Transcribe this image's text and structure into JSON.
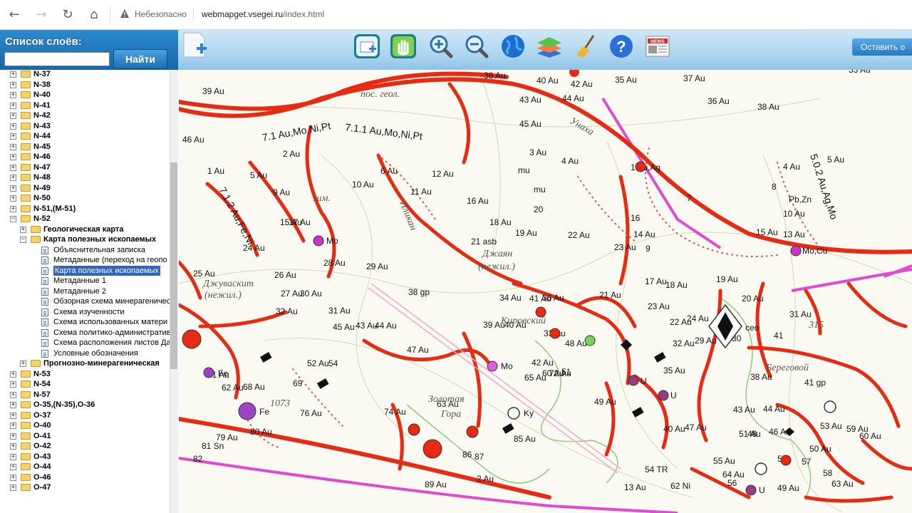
{
  "browser": {
    "insecure_label": "Небезопасно",
    "url_host": "webmapget.vsegei.ru",
    "url_path": "/index.html"
  },
  "header": {
    "layers_title": "Список слоёв:",
    "search_value": "",
    "find_label": "Найти",
    "leave_label": "Оставить о"
  },
  "tree": {
    "before": [
      "N-37",
      "N-38",
      "N-40",
      "N-41",
      "N-42",
      "N-43",
      "N-44",
      "N-45",
      "N-46",
      "N-47",
      "N-48",
      "N-49",
      "N-50",
      "N-51,(M-51)",
      "N-52"
    ],
    "n52_children": [
      "Геологическая карта",
      "Карта полезных ископаемых"
    ],
    "map_children": [
      "Объяснительная записка",
      "Метаданные (переход на геопо",
      "Карта полезных ископаемых",
      "Метаданные 1",
      "Метаданные 2",
      "Обзорная схема минерагеничес",
      "Схема изученности",
      "Схема использованных матери",
      "Схема политико-административ",
      "Схема расположения листов Да",
      "Условные обозначения"
    ],
    "forecast": "Прогнозно-минерагеническая",
    "after": [
      "N-53",
      "N-54",
      "N-57",
      "O-35,(N-35),O-36",
      "O-37",
      "O-40",
      "O-41",
      "O-42",
      "O-43",
      "O-44",
      "O-46",
      "O-47"
    ]
  },
  "map": {
    "labels": [
      "39 Au",
      "38 Au",
      "40 Au",
      "42 Au",
      "35 Au",
      "43 Au",
      "44 Au",
      "37 Au",
      "36 Au",
      "38 Au",
      "45 Au",
      "46 Au",
      "33 Au",
      "2 Au",
      "3 Au",
      "4 Au",
      "1 Au",
      "5 Au",
      "6 Au",
      "12 Au",
      "9 Au",
      "10 Au",
      "11 Au",
      "16 Au",
      "15 Au",
      "17 Au",
      "18 Au",
      "19 Au",
      "20",
      "22 Au",
      "23 Au",
      "24 Au",
      "25 Au",
      "26 Au",
      "27 Au",
      "28 Au",
      "29 Au",
      "30 Au",
      "31 Au",
      "32 Au",
      "33 Au",
      "34 Au",
      "36 Au",
      "39 Au",
      "40 Au",
      "41 Au",
      "42 Au",
      "43 Au",
      "44 Au",
      "45 Au",
      "47 Au",
      "48 Au",
      "49 Au",
      "51",
      "52 Au",
      "54",
      "60 Au",
      "61 Au",
      "62 Au",
      "63 Au",
      "65 Au",
      "68 Au",
      "69",
      "72 Au",
      "74 Au",
      "76 Au",
      "79 Au",
      "80 Au",
      "81 Sn",
      "82",
      "85 Au",
      "86",
      "87",
      "88",
      "89 Au",
      "2 Au",
      "4 Au",
      "5 Au",
      "7",
      "8",
      "10 Au",
      "13 Au",
      "14 Au",
      "15 Au",
      "17 Au",
      "18 Au",
      "19 Au",
      "20 Au",
      "21 Au",
      "22 Au",
      "23 Au",
      "24 Au",
      "27",
      "29 Au",
      "30",
      "31 Au",
      "32 Au",
      "35 Au",
      "38 Au",
      "40 Au",
      "41",
      "43 Au",
      "44 Au",
      "46 Au",
      "47 Au",
      "48",
      "49 Au",
      "50 Au",
      "51 Au",
      "52",
      "53 Au",
      "55 Au",
      "56",
      "57",
      "58",
      "59 Au",
      "60 Au",
      "62 Ni",
      "63 Au",
      "64 Au",
      "13 Au",
      "9",
      "16"
    ],
    "annotations": {
      "trend_1": "7.1 Au,Mo,Ni,Pt",
      "trend_2": "7.1.1 Au,Mo,Ni,Pt",
      "trend_3": "7.1.2 Au,Fe,Ni",
      "trend_4": "5.0.2 Au,Ag,Mo",
      "pos_geol": "пос. геол.",
      "zim": "зим.",
      "dzhayan": "Джаян",
      "nezhil": "(нежил.)",
      "dzhuvaskit": "Джуваскит",
      "nezhil2": "(нежил.)",
      "kirovskiy": "Кировский",
      "zolotaya": "Золотая",
      "gora": "Гора",
      "beregovoy": "Береговой",
      "unakha": "Унаха",
      "elev_1073": "1073",
      "elev_315": "315",
      "ilikan": "Иликан",
      "mo20": "Mo",
      "mo16": "Mo,Cu",
      "mo64": "Mo",
      "fe73": "Fe",
      "fe71": "Fe",
      "ag1": "1 Au,Ag",
      "pbzn": "Pb,Zn",
      "mu7": "mu",
      "mu13": "mu",
      "asb21": "21 asb",
      "gp38": "38 gp",
      "gp41": "41 gp",
      "ce": "ceo",
      "ky": "Ky",
      "u36": "U",
      "u39": "U",
      "u63": "U",
      "tr": "54 TR"
    }
  }
}
